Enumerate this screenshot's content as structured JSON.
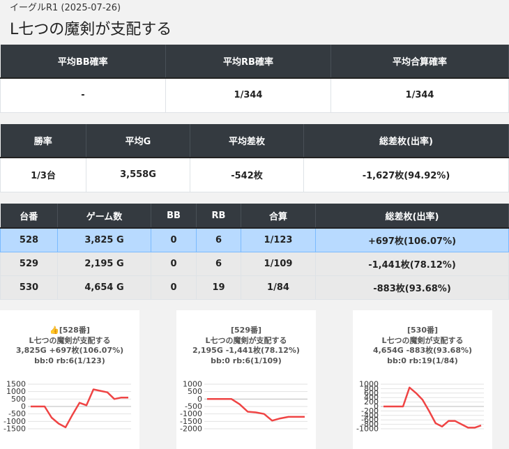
{
  "header": {
    "subtitle": "イーグルR1 (2025-07-26)",
    "title": "L七つの魔剣が支配する"
  },
  "summary1": {
    "headers": [
      "平均BB確率",
      "平均RB確率",
      "平均合算確率"
    ],
    "values": [
      "-",
      "1/344",
      "1/344"
    ]
  },
  "summary2": {
    "headers": [
      "勝率",
      "平均G",
      "平均差枚",
      "総差枚(出率)"
    ],
    "values": [
      "1/3台",
      "3,558G",
      "-542枚",
      "-1,627枚(94.92%)"
    ]
  },
  "machines": {
    "headers": [
      "台番",
      "ゲーム数",
      "BB",
      "RB",
      "合算",
      "総差枚(出率)"
    ],
    "rows": [
      [
        "528",
        "3,825 G",
        "0",
        "6",
        "1/123",
        "+697枚(106.07%)"
      ],
      [
        "529",
        "2,195 G",
        "0",
        "6",
        "1/109",
        "-1,441枚(78.12%)"
      ],
      [
        "530",
        "4,654 G",
        "0",
        "19",
        "1/84",
        "-883枚(93.68%)"
      ]
    ]
  },
  "cards": [
    {
      "icon": "👍",
      "number": "[528番]",
      "name": "L七つの魔剣が支配する",
      "stats": "3,825G +697枚(106.07%)",
      "bonus": "bb:0 rb:6(1/123)"
    },
    {
      "icon": "",
      "number": "[529番]",
      "name": "L七つの魔剣が支配する",
      "stats": "2,195G -1,441枚(78.12%)",
      "bonus": "bb:0 rb:6(1/109)"
    },
    {
      "icon": "",
      "number": "[530番]",
      "name": "L七つの魔剣が支配する",
      "stats": "4,654G -883枚(93.68%)",
      "bonus": "bb:0 rb:19(1/84)"
    }
  ],
  "colors": {
    "line": "#ef4444",
    "highlight_row": "#b8daff",
    "header_bg": "#343a40"
  },
  "chart_data": [
    {
      "type": "line",
      "ylim": [
        -1500,
        1500
      ],
      "yticks": [
        1500,
        1000,
        500,
        0,
        -500,
        -1000,
        -1500
      ],
      "y": [
        0,
        0,
        0,
        -750,
        -1150,
        -1400,
        -550,
        250,
        80,
        1150,
        1050,
        950,
        500,
        600,
        600
      ]
    },
    {
      "type": "line",
      "ylim": [
        -2000,
        1000
      ],
      "yticks": [
        1000,
        500,
        0,
        -500,
        -1000,
        -1500,
        -2000
      ],
      "y": [
        0,
        0,
        0,
        0,
        -350,
        -850,
        -900,
        -1000,
        -1450,
        -1300,
        -1200,
        -1200,
        -1200
      ]
    },
    {
      "type": "line",
      "ylim": [
        -1000,
        1000
      ],
      "yticks": [
        1000,
        800,
        600,
        400,
        200,
        0,
        -200,
        -400,
        -600,
        -800,
        -1000
      ],
      "y": [
        0,
        0,
        0,
        0,
        850,
        600,
        300,
        -200,
        -750,
        -900,
        -650,
        -650,
        -800,
        -950,
        -950,
        -850
      ]
    }
  ]
}
